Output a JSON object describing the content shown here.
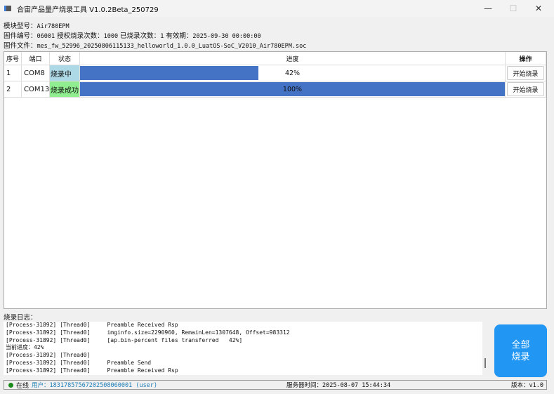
{
  "window": {
    "title": "合宙产品量产烧录工具 V1.0.2Beta_250729",
    "minimize": "—",
    "maximize": "☐",
    "close": "✕"
  },
  "info": {
    "module_label": "模块型号：",
    "module": "Air780EPM",
    "firmware_no_label": "固件编号：",
    "firmware_no": "06001",
    "auth_label": "授权烧录次数：",
    "auth": "1000",
    "burned_label": "已烧录次数：",
    "burned": "1",
    "valid_label": "有效期：",
    "valid": "2025-09-30 00:00:00",
    "file_label": "固件文件：",
    "file": "mes_fw_52996_20250806115133_helloworld_1.0.0_LuatOS-SoC_V2010_Air780EPM.soc"
  },
  "table": {
    "headers": [
      "序号",
      "端口",
      "状态",
      "进度",
      "操作"
    ],
    "rows": [
      {
        "no": "1",
        "port": "COM8",
        "status": "烧录中",
        "status_color": "#add8e6",
        "progress": 42,
        "progress_text": "42%",
        "action": "开始烧录"
      },
      {
        "no": "2",
        "port": "COM13",
        "status": "烧录成功",
        "status_color": "#90ee90",
        "progress": 100,
        "progress_text": "100%",
        "action": "开始烧录"
      }
    ]
  },
  "log": {
    "label": "烧录日志：",
    "lines": [
      "[Process-31892] [Thread0]     Preamble Received Rsp",
      "[Process-31892] [Thread0]     imginfo.size=2290960, RemainLen=1307648, Offset=983312",
      "[Process-31892] [Thread0]     [ap.bin-percent files transferred   42%]",
      "当前进度：42%",
      "[Process-31892] [Thread0]",
      "[Process-31892] [Thread0]     Preamble Send",
      "[Process-31892] [Thread0]     Preamble Received Rsp"
    ]
  },
  "burn_all_button": {
    "line1": "全部",
    "line2": "烧录"
  },
  "status_bar": {
    "online": "在线",
    "user": "用户：18317857567202508060001 (user)",
    "server_time": "服务器时间：2025-08-07 15:44:34",
    "version": "版本：v1.0"
  }
}
